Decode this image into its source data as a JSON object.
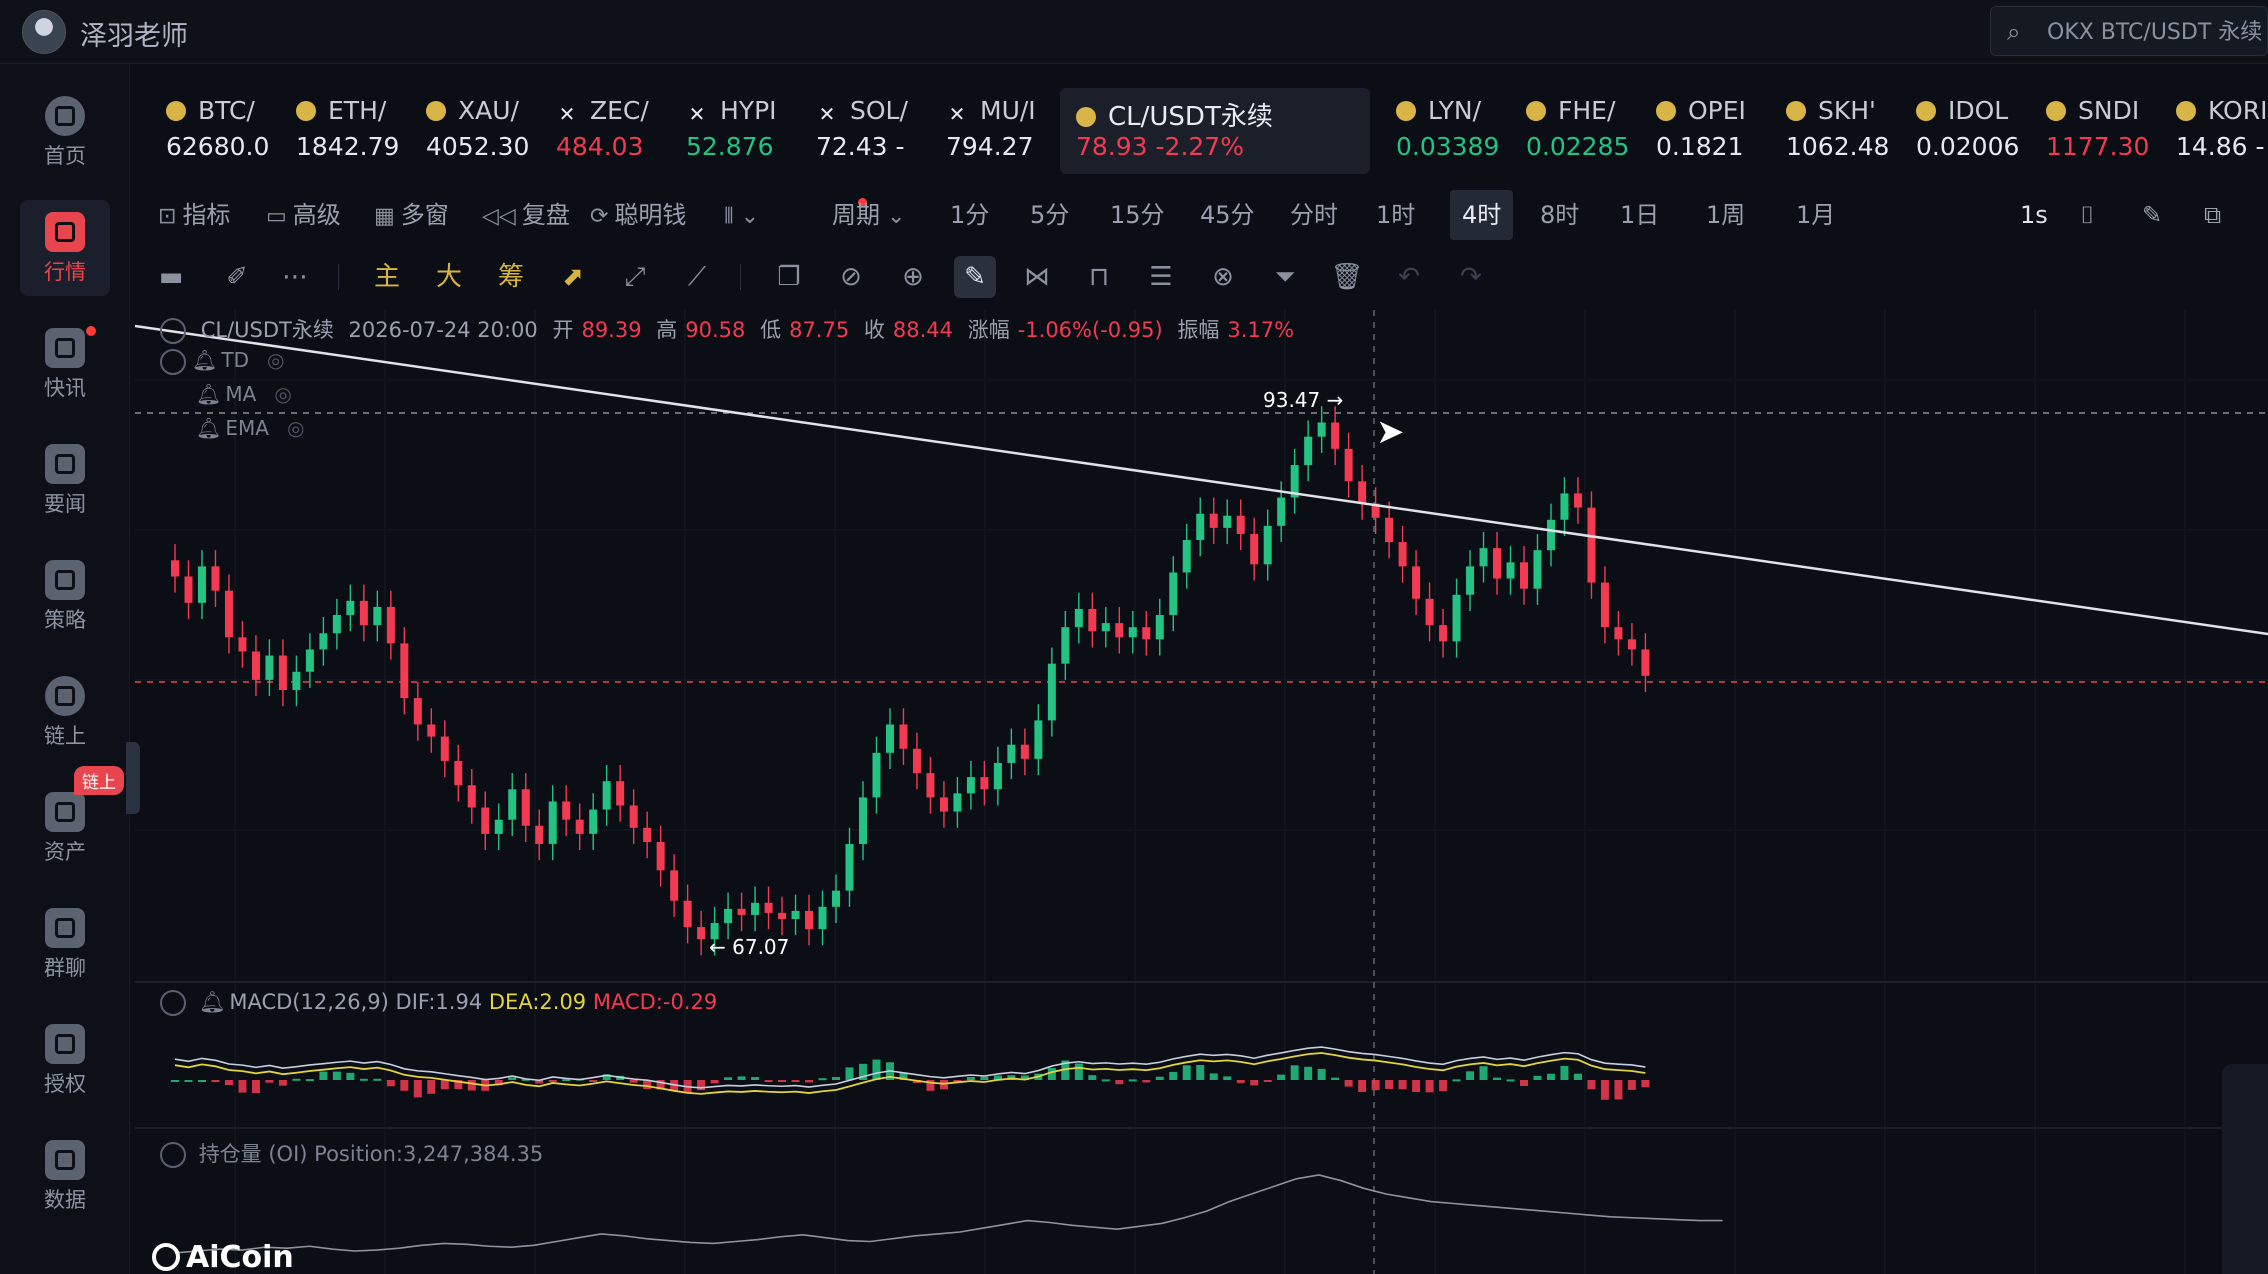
{
  "header": {
    "app_title": "泽羽老师",
    "search_placeholder": "OKX BTC/USDT 永续"
  },
  "sidebar": {
    "items": [
      {
        "label": "首页",
        "icon": "home-icon"
      },
      {
        "label": "行情",
        "icon": "market-chart-icon",
        "active": true
      },
      {
        "label": "快讯",
        "icon": "news-flash-icon"
      },
      {
        "label": "要闻",
        "icon": "headline-icon"
      },
      {
        "label": "策略",
        "icon": "robot-strategy-icon"
      },
      {
        "label": "链上",
        "icon": "onchain-icon"
      },
      {
        "label": "资产",
        "icon": "wallet-icon"
      },
      {
        "label": "群聊",
        "icon": "chat-icon"
      },
      {
        "label": "授权",
        "icon": "authorize-icon"
      },
      {
        "label": "数据",
        "icon": "data-icon"
      }
    ],
    "badge": "链上"
  },
  "tickers": [
    {
      "sym": "BTC/",
      "price": "62680.0",
      "color": "white",
      "coin": "dot"
    },
    {
      "sym": "ETH/",
      "price": "1842.79",
      "color": "white",
      "coin": "dot"
    },
    {
      "sym": "XAU/",
      "price": "4052.30",
      "color": "white",
      "coin": "dot"
    },
    {
      "sym": "ZEC/",
      "price": "484.03",
      "color": "red",
      "coin": "x"
    },
    {
      "sym": "HYPI",
      "price": "52.876",
      "color": "green",
      "coin": "x"
    },
    {
      "sym": "SOL/",
      "price": "72.43 -",
      "color": "white",
      "coin": "x"
    },
    {
      "sym": "MU/I",
      "price": "794.27",
      "color": "white",
      "coin": "x"
    },
    {
      "sym": "CL/USDT永续",
      "price": "78.93 -2.27%",
      "color": "red",
      "coin": "dot",
      "active": true
    },
    {
      "sym": "LYN/",
      "price": "0.03389",
      "color": "green",
      "coin": "dot"
    },
    {
      "sym": "FHE/",
      "price": "0.02285",
      "color": "green",
      "coin": "dot"
    },
    {
      "sym": "OPEI",
      "price": "0.1821",
      "color": "white",
      "coin": "dot"
    },
    {
      "sym": "SKH'",
      "price": "1062.48",
      "color": "white",
      "coin": "dot"
    },
    {
      "sym": "IDOL",
      "price": "0.02006",
      "color": "white",
      "coin": "dot"
    },
    {
      "sym": "SNDI",
      "price": "1177.30",
      "color": "red",
      "coin": "dot"
    },
    {
      "sym": "KORI",
      "price": "14.86 -",
      "color": "white",
      "coin": "dot"
    }
  ],
  "toolbar": {
    "indicator": "指标",
    "advanced": "高级",
    "multiwin": "多窗",
    "replay": "复盘",
    "smart_money": "聪明钱",
    "period_label": "周期",
    "periods": [
      "1分",
      "5分",
      "15分",
      "45分",
      "分时",
      "1时",
      "4时",
      "8时",
      "1日",
      "1周",
      "1月"
    ],
    "active_period": "4时",
    "interval": "1s"
  },
  "drawing_tools": {
    "main": "主",
    "big": "大",
    "chips": "筹"
  },
  "ohlc": {
    "symbol": "CL/USDT永续",
    "datetime": "2026-07-24 20:00",
    "open_label": "开",
    "open": "89.39",
    "high_label": "高",
    "high": "90.58",
    "low_label": "低",
    "low": "87.75",
    "close_label": "收",
    "close": "88.44",
    "change_label": "涨幅",
    "change": "-1.06%(-0.95)",
    "amp_label": "振幅",
    "amp": "3.17%"
  },
  "overlays": [
    "TD",
    "MA",
    "EMA"
  ],
  "price_marks": {
    "high": "93.47",
    "low": "67.07"
  },
  "macd": {
    "label": "MACD(12,26,9)",
    "dif": "DIF:1.94",
    "dea": "DEA:2.09",
    "macd": "MACD:-0.29"
  },
  "oi": {
    "label": "持仓量 (OI)",
    "position": "Position:3,247,384.35"
  },
  "brand": "AiCoin",
  "colors": {
    "up": "#24c383",
    "down": "#f23b52",
    "accent": "#e8464f",
    "dea": "#e3d33c"
  },
  "chart_data": {
    "type": "candlestick",
    "series": [
      {
        "values": [
          85.5,
          84.2,
          86.0,
          84.8,
          82.5,
          81.8,
          80.4,
          81.6,
          79.9,
          80.8,
          81.9,
          82.7,
          83.6,
          84.3,
          83.1,
          84.0,
          82.2,
          79.5,
          78.2,
          77.6,
          76.4,
          75.2,
          74.1,
          72.8,
          73.5,
          75.0,
          73.2,
          72.3,
          74.4,
          73.5,
          72.8,
          74.0,
          75.4,
          74.2,
          73.1,
          72.4,
          71.0,
          69.5,
          68.2,
          67.6,
          68.4,
          69.1,
          68.8,
          69.4,
          68.9,
          68.6,
          69.0,
          68.1,
          69.2,
          70.0,
          72.3,
          74.6,
          76.8,
          78.2,
          77.0,
          75.8,
          74.6,
          73.9,
          74.8,
          75.6,
          75.0,
          76.3,
          77.2,
          76.5,
          78.4,
          81.2,
          83.0,
          83.9,
          82.8,
          83.2,
          82.5,
          83.0,
          82.4,
          83.6,
          85.7,
          87.3,
          88.6,
          87.9,
          88.5,
          87.6,
          86.1,
          88.0,
          89.4,
          91.0,
          92.4,
          93.1,
          91.8,
          90.2,
          89.1,
          88.4,
          87.2,
          86.0,
          84.4,
          83.1,
          82.3,
          84.6,
          86.0,
          86.9,
          85.4,
          86.2,
          84.9,
          86.8,
          88.3,
          89.6,
          88.9,
          85.2,
          83.0,
          82.4,
          81.9,
          80.6
        ]
      }
    ],
    "price_high": 93.47,
    "price_low": 67.07,
    "oi_values": [
      18,
      20,
      22,
      21,
      24,
      23,
      25,
      22,
      20,
      21,
      23,
      26,
      28,
      27,
      25,
      24,
      26,
      30,
      34,
      38,
      36,
      33,
      31,
      29,
      28,
      30,
      32,
      35,
      37,
      34,
      31,
      30,
      33,
      36,
      38,
      40,
      44,
      48,
      52,
      50,
      47,
      45,
      43,
      46,
      49,
      55,
      62,
      72,
      80,
      88,
      96,
      100,
      94,
      86,
      80,
      76,
      72,
      70,
      68,
      66,
      64,
      62,
      60,
      58,
      56,
      55,
      54,
      53,
      52,
      52
    ]
  }
}
